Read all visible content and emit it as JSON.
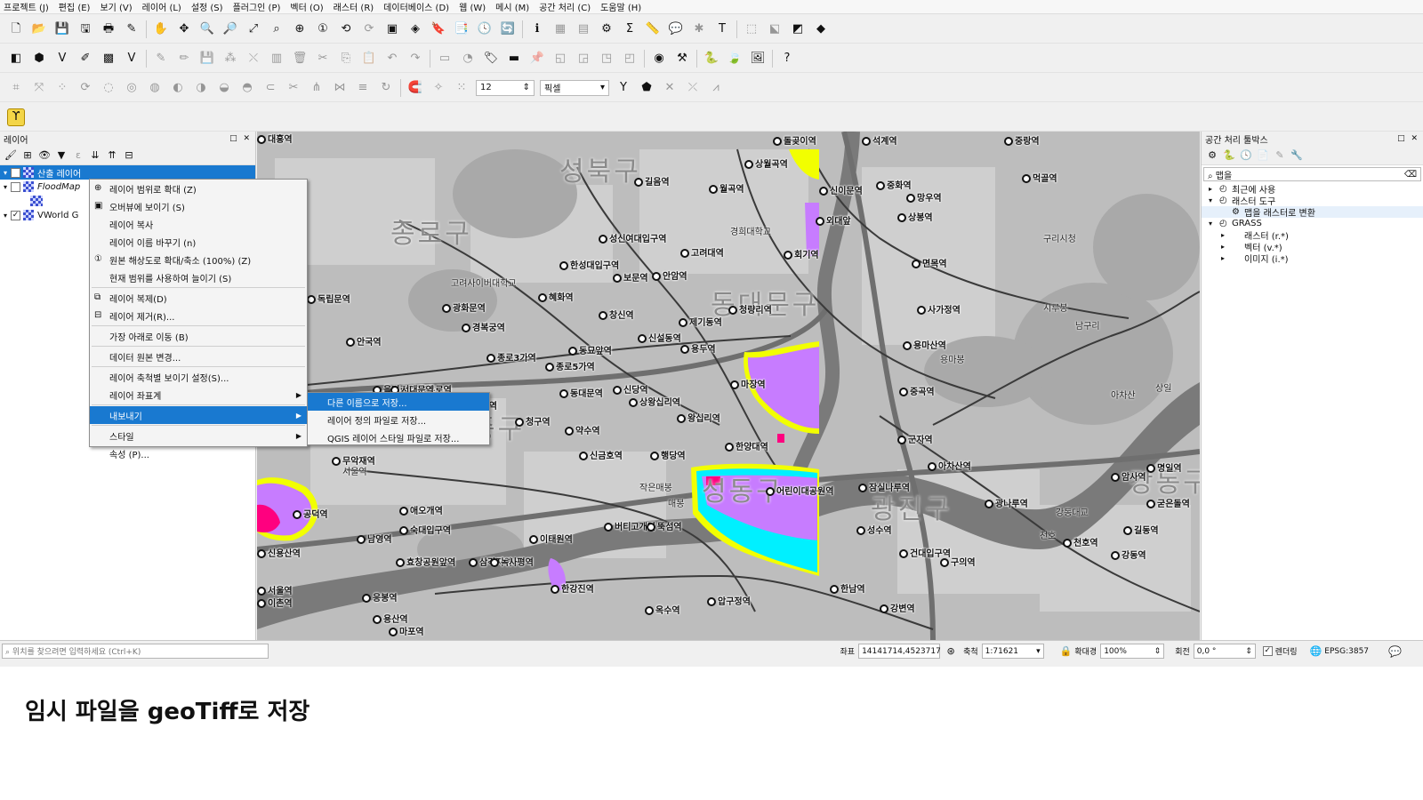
{
  "menubar": [
    "프로젝트 (J)",
    "편집 (E)",
    "보기 (V)",
    "레이어 (L)",
    "설정 (S)",
    "플러그인 (P)",
    "벡터 (O)",
    "래스터 (R)",
    "데이터베이스 (D)",
    "웹 (W)",
    "메시 (M)",
    "공간 처리 (C)",
    "도움말 (H)"
  ],
  "toolbar": {
    "snap_tolerance": "12",
    "snap_units": "픽셀"
  },
  "layers_panel": {
    "title": "레이어",
    "controls": "□ ✕",
    "layers": [
      {
        "name": "산출 레이어",
        "checked": true,
        "selected": true
      },
      {
        "name": "FloodMap",
        "checked": false,
        "selected": false
      },
      {
        "name": "VWorld G",
        "checked": true,
        "selected": false
      }
    ]
  },
  "context_menu": {
    "items": [
      {
        "label": "레이어 범위로 확대 (Z)",
        "icon": "zoom-layer-icon"
      },
      {
        "label": "오버뷰에 보이기 (S)",
        "icon": "overview-icon"
      },
      {
        "label": "레이어 복사",
        "icon": ""
      },
      {
        "label": "레이어 이름 바꾸기 (n)",
        "icon": ""
      },
      {
        "label": "원본 해상도로 확대/축소 (100%) (Z)",
        "icon": "zoom-native-icon"
      },
      {
        "label": "현재 범위를 사용하여 늘이기 (S)",
        "icon": ""
      },
      {
        "label": "레이어 복제(D)",
        "icon": "duplicate-icon",
        "sep_before": true
      },
      {
        "label": "레이어 제거(R)...",
        "icon": "remove-layer-icon"
      },
      {
        "label": "가장 아래로 이동 (B)",
        "icon": "",
        "sep_before": true
      },
      {
        "label": "데이터 원본 변경...",
        "icon": "",
        "sep_before": true
      },
      {
        "label": "레이어 축척별 보이기 설정(S)...",
        "icon": "",
        "sep_before": true
      },
      {
        "label": "레이어 좌표계",
        "icon": "",
        "submenu": true
      },
      {
        "label": "내보내기",
        "icon": "",
        "submenu": true,
        "highlighted": true,
        "sep_before": true
      },
      {
        "label": "스타일",
        "icon": "",
        "submenu": true,
        "sep_before": true
      },
      {
        "label": "속성 (P)...",
        "icon": ""
      }
    ]
  },
  "export_submenu": [
    "다른 이름으로 저장...",
    "레이어 정의 파일로 저장...",
    "QGIS 레이어 스타일 파일로 저장..."
  ],
  "map": {
    "districts": [
      {
        "text": "성북구",
        "cls": "dist"
      },
      {
        "text": "종로구",
        "cls": "dist"
      },
      {
        "text": "동대문구",
        "cls": "dist"
      },
      {
        "text": "중구",
        "cls": "dist"
      },
      {
        "text": "성동구",
        "cls": "dist"
      },
      {
        "text": "광진구",
        "cls": "dist"
      },
      {
        "text": "강동구",
        "cls": "dist"
      }
    ],
    "stations": [
      "돌곶이역",
      "석계역",
      "상월곡역",
      "신이문역",
      "외대앞",
      "회기역",
      "청량리역",
      "제기동역",
      "신설동역",
      "동묘앞역",
      "창신역",
      "혜화역",
      "한성대입구역",
      "성신여대입구역",
      "보문역",
      "안암역",
      "고려대역",
      "월곡역",
      "길음역",
      "중화역",
      "상봉역",
      "망우역",
      "먹골역",
      "중랑역",
      "면목역",
      "사가정역",
      "용마산역",
      "중곡역",
      "군자역",
      "아차산역",
      "광나루역",
      "천호역",
      "강동역",
      "길동역",
      "암사역",
      "명일역",
      "굳은돌역",
      "종로3가역",
      "종로5가역",
      "동대문역",
      "신당역",
      "상왕십리역",
      "왕십리역",
      "마장역",
      "용두역",
      "한양대역",
      "행당역",
      "신금호역",
      "약수역",
      "청구역",
      "동대입구역",
      "충무로역",
      "을지로입구역",
      "서대문역",
      "광화문역",
      "경복궁역",
      "안국역",
      "독립문역",
      "무악재역",
      "애오개역",
      "숙대입구역",
      "남영역",
      "효창공원앞역",
      "삼각지역",
      "녹사평역",
      "이태원역",
      "한강진역",
      "버티고개역",
      "옥수역",
      "압구정역",
      "한남역",
      "뚝섬역",
      "성수역",
      "건대입구역",
      "구의역",
      "강변역",
      "잠실나루역",
      "어린이대공원역",
      "응봉역",
      "용산역",
      "신용산역",
      "마포역",
      "이촌역",
      "서울역",
      "공덕역",
      "대흥역"
    ],
    "areas": [
      "경희대학교",
      "고려사이버대학교",
      "구리시청",
      "남구리",
      "시루봉",
      "용마봉",
      "매봉",
      "작은매봉",
      "아차산",
      "서울역",
      "강동대교",
      "천호",
      "상일"
    ]
  },
  "processing_panel": {
    "title": "공간 처리 툴박스",
    "search": "맵을",
    "tree": [
      {
        "label": "최근에 사용",
        "level": 0,
        "expand": "▸"
      },
      {
        "label": "래스터 도구",
        "level": 0,
        "expand": "▾"
      },
      {
        "label": "맵을 래스터로 변환",
        "level": 1,
        "expand": "",
        "selected": true
      },
      {
        "label": "GRASS",
        "level": 0,
        "expand": "▾"
      },
      {
        "label": "래스터 (r.*)",
        "level": 1,
        "expand": "▸"
      },
      {
        "label": "벡터 (v.*)",
        "level": 1,
        "expand": "▸"
      },
      {
        "label": "이미지 (i.*)",
        "level": 1,
        "expand": "▸"
      }
    ]
  },
  "statusbar": {
    "locator_placeholder": "위치를 찾으려면 입력하세요 (Ctrl+K)",
    "coord_label": "좌표",
    "coord_value": "14141714,4523717",
    "scale_label": "축척",
    "scale_value": "1:71621",
    "magnifier_label": "확대경",
    "magnifier_value": "100%",
    "rotation_label": "회전",
    "rotation_value": "0,0 °",
    "render_label": "렌더링",
    "crs": "EPSG:3857"
  },
  "caption": "임시 파일을 geoTiff로 저장",
  "colors": {
    "flood_violet": "#c77cff",
    "flood_cyan": "#00f0ff",
    "flood_yellow": "#f2ff00",
    "flood_magenta": "#ff007f",
    "highlight": "#1979d0"
  }
}
